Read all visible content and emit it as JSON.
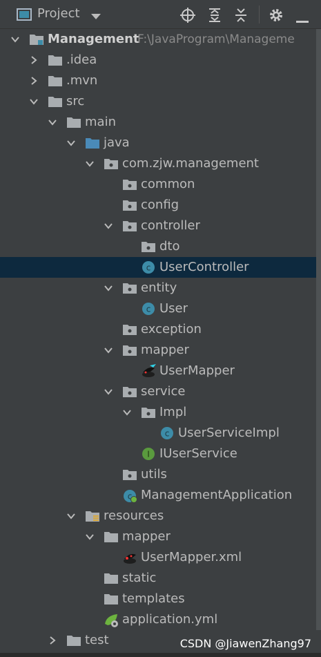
{
  "panel": {
    "title": "Project",
    "toolbar": [
      "locate-icon",
      "expand-all-icon",
      "collapse-all-icon",
      "gear-icon",
      "minimize-icon"
    ]
  },
  "tree": [
    {
      "label": "Management",
      "path": "F:\\JavaProgram\\Manageme",
      "depth": 0,
      "arrow": "down",
      "icon": "module-folder",
      "bold": true
    },
    {
      "label": ".idea",
      "depth": 1,
      "arrow": "right",
      "icon": "folder"
    },
    {
      "label": ".mvn",
      "depth": 1,
      "arrow": "right",
      "icon": "folder"
    },
    {
      "label": "src",
      "depth": 1,
      "arrow": "down",
      "icon": "folder"
    },
    {
      "label": "main",
      "depth": 2,
      "arrow": "down",
      "icon": "folder"
    },
    {
      "label": "java",
      "depth": 3,
      "arrow": "down",
      "icon": "source-folder"
    },
    {
      "label": "com.zjw.management",
      "depth": 4,
      "arrow": "down",
      "icon": "package"
    },
    {
      "label": "common",
      "depth": 5,
      "arrow": "none",
      "icon": "package"
    },
    {
      "label": "config",
      "depth": 5,
      "arrow": "none",
      "icon": "package"
    },
    {
      "label": "controller",
      "depth": 5,
      "arrow": "down",
      "icon": "package"
    },
    {
      "label": "dto",
      "depth": 6,
      "arrow": "none",
      "icon": "package"
    },
    {
      "label": "UserController",
      "depth": 6,
      "arrow": "none",
      "icon": "class",
      "selected": true
    },
    {
      "label": "entity",
      "depth": 5,
      "arrow": "down",
      "icon": "package"
    },
    {
      "label": "User",
      "depth": 6,
      "arrow": "none",
      "icon": "class"
    },
    {
      "label": "exception",
      "depth": 5,
      "arrow": "none",
      "icon": "package"
    },
    {
      "label": "mapper",
      "depth": 5,
      "arrow": "down",
      "icon": "package"
    },
    {
      "label": "UserMapper",
      "depth": 6,
      "arrow": "none",
      "icon": "mybatis"
    },
    {
      "label": "service",
      "depth": 5,
      "arrow": "down",
      "icon": "package"
    },
    {
      "label": "Impl",
      "depth": 6,
      "arrow": "down",
      "icon": "package"
    },
    {
      "label": "UserServiceImpl",
      "depth": 7,
      "arrow": "none",
      "icon": "class"
    },
    {
      "label": "IUserService",
      "depth": 6,
      "arrow": "none",
      "icon": "interface"
    },
    {
      "label": "utils",
      "depth": 5,
      "arrow": "none",
      "icon": "package"
    },
    {
      "label": "ManagementApplication",
      "depth": 5,
      "arrow": "none",
      "icon": "spring-app"
    },
    {
      "label": "resources",
      "depth": 3,
      "arrow": "down",
      "icon": "resources-folder"
    },
    {
      "label": "mapper",
      "depth": 4,
      "arrow": "down",
      "icon": "folder"
    },
    {
      "label": "UserMapper.xml",
      "depth": 5,
      "arrow": "none",
      "icon": "mybatis-xml"
    },
    {
      "label": "static",
      "depth": 4,
      "arrow": "none",
      "icon": "folder"
    },
    {
      "label": "templates",
      "depth": 4,
      "arrow": "none",
      "icon": "folder"
    },
    {
      "label": "application.yml",
      "depth": 4,
      "arrow": "none",
      "icon": "yaml-config"
    },
    {
      "label": "test",
      "depth": 2,
      "arrow": "right",
      "icon": "folder"
    }
  ],
  "colors": {
    "background": "#3c3f41",
    "selection": "#0d293e",
    "text": "#bbbbbb",
    "class_icon": "#3d8ca8",
    "interface_icon": "#5a9a3e",
    "folder": "#a9adb0",
    "source_folder": "#4a8ab8"
  },
  "watermark": "CSDN @JiawenZhang97"
}
